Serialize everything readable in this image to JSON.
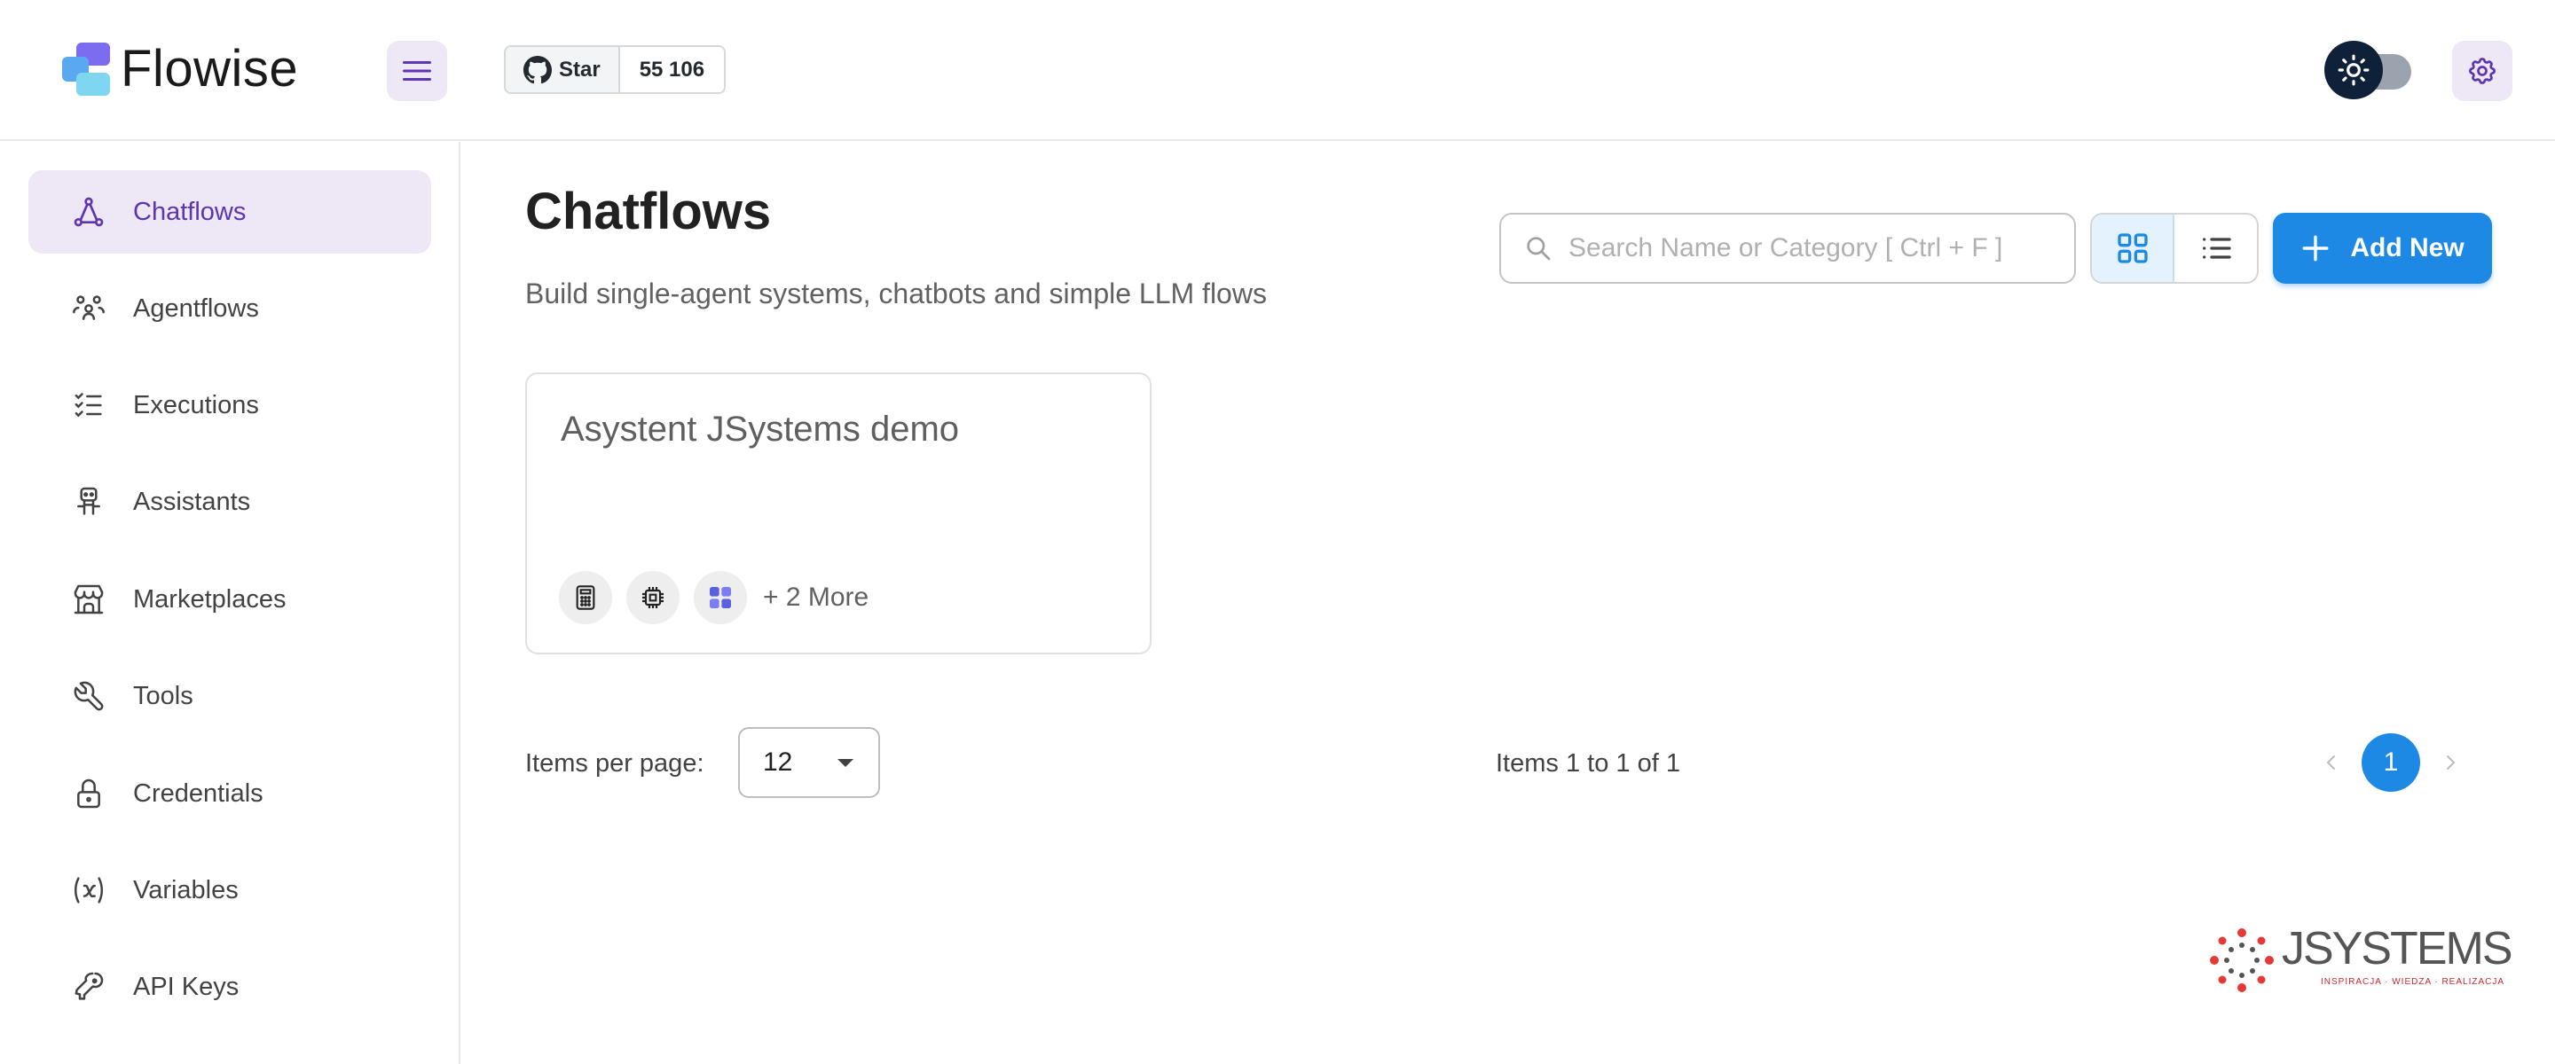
{
  "app": {
    "name": "Flowise"
  },
  "header": {
    "github_star_label": "Star",
    "github_star_count": "55 106"
  },
  "sidebar": {
    "items": [
      {
        "label": "Chatflows",
        "icon": "hierarchy-icon",
        "active": true
      },
      {
        "label": "Agentflows",
        "icon": "users-group-icon",
        "active": false
      },
      {
        "label": "Executions",
        "icon": "list-check-icon",
        "active": false
      },
      {
        "label": "Assistants",
        "icon": "robot-icon",
        "active": false
      },
      {
        "label": "Marketplaces",
        "icon": "building-store-icon",
        "active": false
      },
      {
        "label": "Tools",
        "icon": "tool-icon",
        "active": false
      },
      {
        "label": "Credentials",
        "icon": "lock-icon",
        "active": false
      },
      {
        "label": "Variables",
        "icon": "variable-icon",
        "active": false
      },
      {
        "label": "API Keys",
        "icon": "key-icon",
        "active": false
      }
    ]
  },
  "main": {
    "title": "Chatflows",
    "subtitle": "Build single-agent systems, chatbots and simple LLM flows",
    "search_placeholder": "Search Name or Category [ Ctrl + F ]",
    "add_button_label": "Add New",
    "view_mode": "grid"
  },
  "cards": [
    {
      "title": "Asystent JSystems demo",
      "node_icons": [
        "calculator-icon",
        "cpu-chip-icon",
        "brand-node-icon"
      ],
      "more_label": "+ 2 More"
    }
  ],
  "pagination": {
    "items_per_page_label": "Items per page:",
    "items_per_page_value": "12",
    "items_range_text": "Items 1 to 1 of 1",
    "current_page": "1"
  },
  "brand": {
    "name": "JSYSTEMS",
    "tagline": "INSPIRACJA · WIEDZA · REALIZACJA"
  },
  "colors": {
    "accent": "#1e88e5",
    "active_nav_bg": "#ede7f6",
    "active_nav_text": "#5e35b1"
  }
}
